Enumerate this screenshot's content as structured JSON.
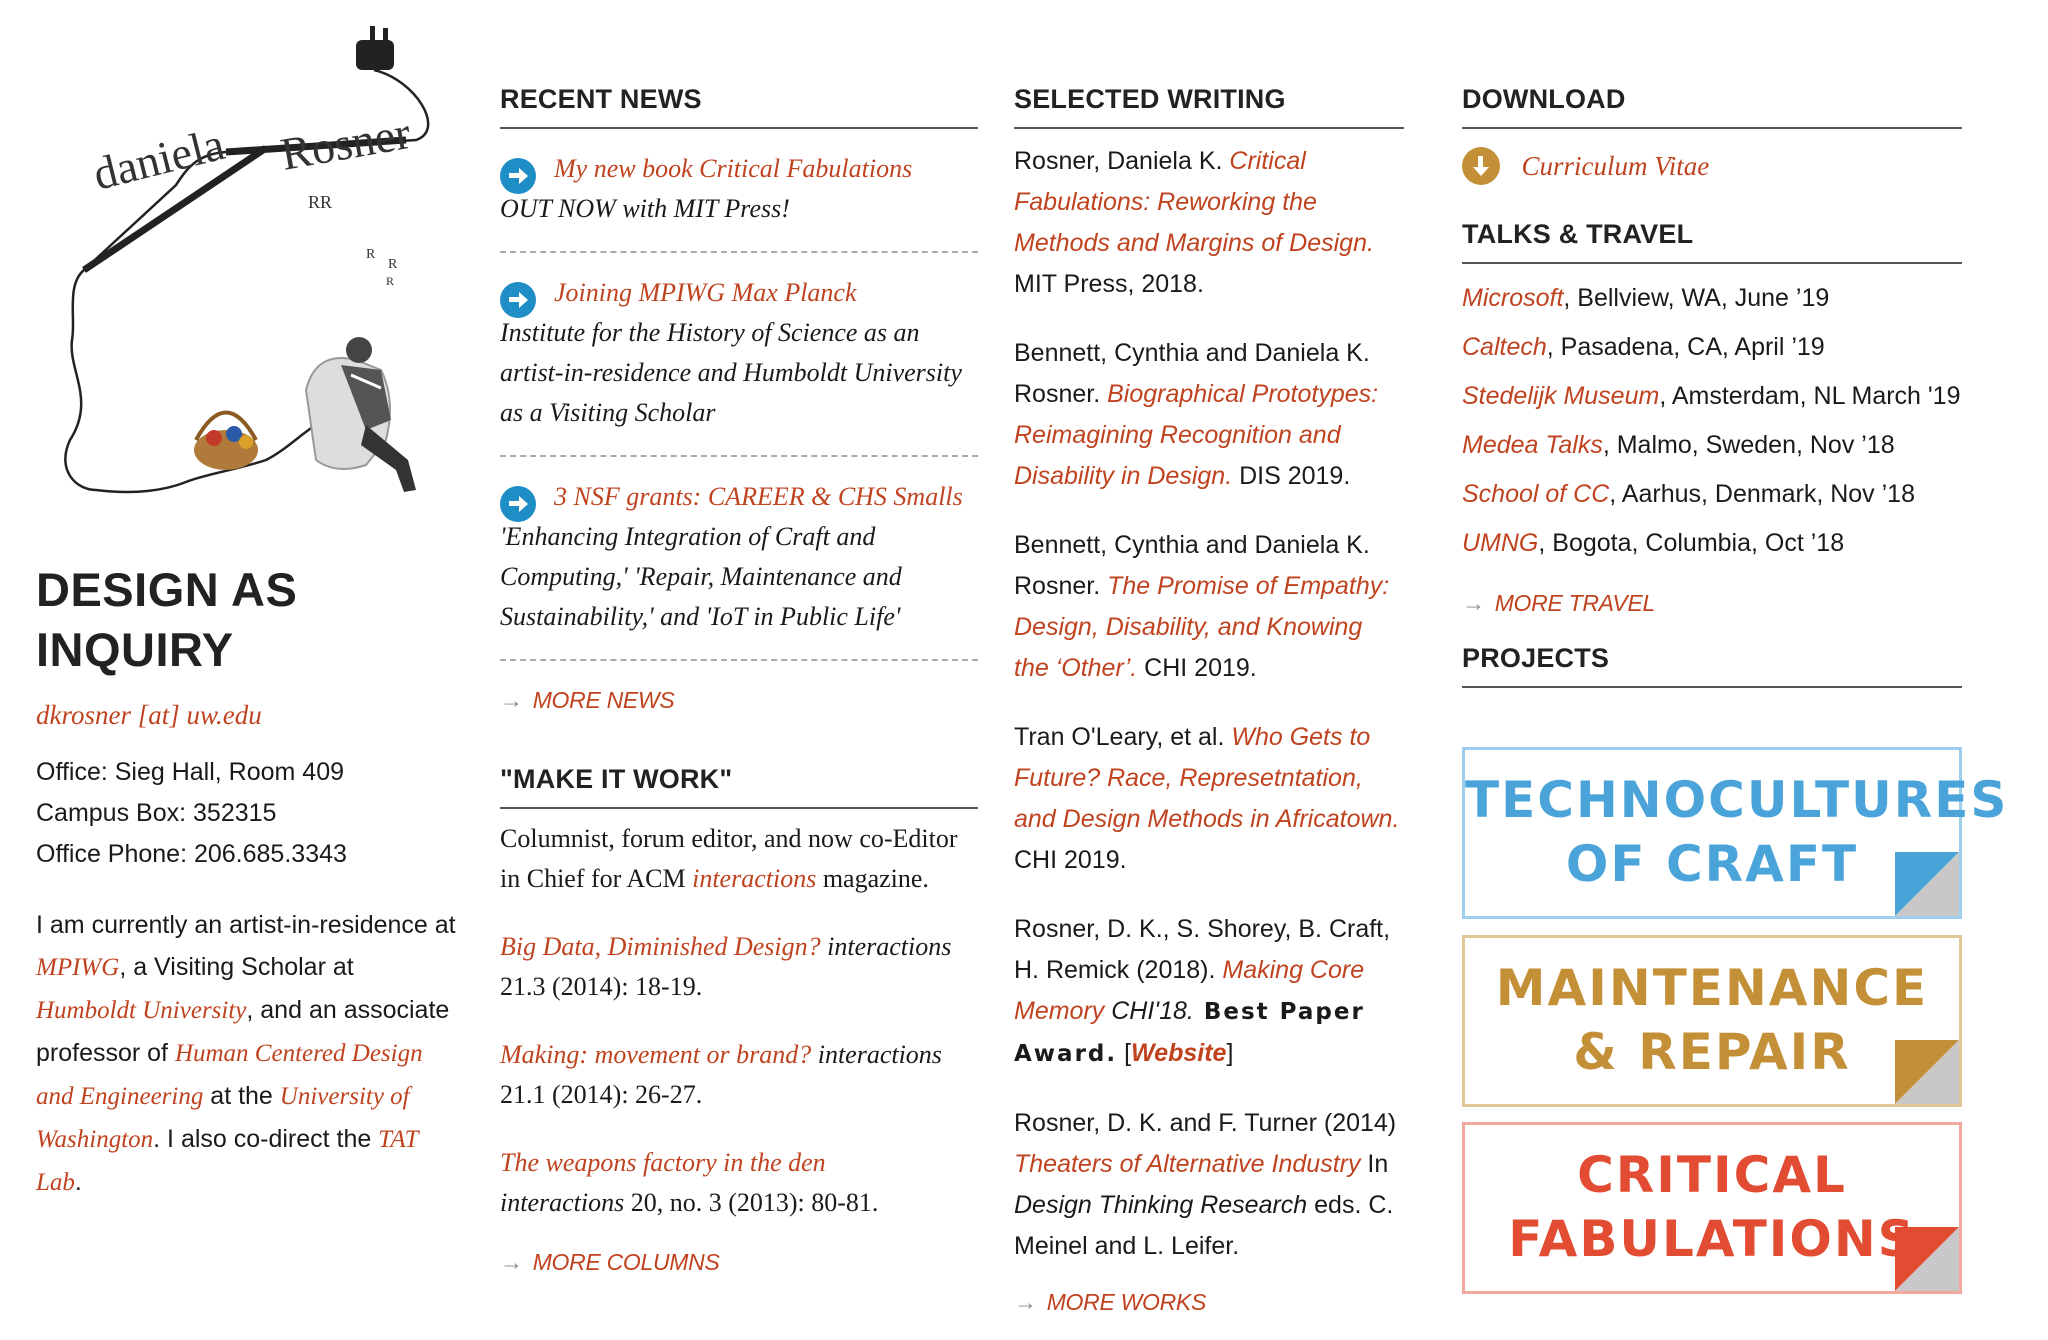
{
  "colors": {
    "accent": "#c0431f",
    "arrow_blue": "#1f8ec7",
    "cv_gold": "#c39037",
    "proj_blue": "#4aa3d9",
    "proj_gold": "#c39037",
    "proj_red": "#e24c32"
  },
  "logo": {
    "first": "daniela",
    "last": "Rosner"
  },
  "sidebar": {
    "title_line1": "DESIGN AS",
    "title_line2": "INQUIRY",
    "email": "dkrosner [at] uw.edu",
    "office": "Office: Sieg Hall, Room 409",
    "box": "Campus Box: 352315",
    "phone": "Office Phone: 206.685.3343",
    "bio_1": "I am currently an artist-in-residence at ",
    "bio_link_1": "MPIWG",
    "bio_2": ", a Visiting Scholar at ",
    "bio_link_2": "Humboldt University",
    "bio_3": ", and an associate professor of ",
    "bio_link_3": "Human Centered Design and Engineering",
    "bio_4": " at the ",
    "bio_link_4": "University of Washington",
    "bio_5": ". I also co-direct the ",
    "bio_link_5": "TAT Lab",
    "bio_6": "."
  },
  "news": {
    "heading": "RECENT NEWS",
    "items": [
      {
        "link": "My new book Critical Fabulations",
        "text": "OUT NOW with MIT Press!"
      },
      {
        "link": "Joining MPIWG Max Planck",
        "text": "Institute for the History of Science as an artist-in-residence and Humboldt University as a Visiting Scholar"
      },
      {
        "link": "3 NSF grants: CAREER & CHS Smalls",
        "text": "'Enhancing Integration of Craft and Computing,' 'Repair, Maintenance and Sustainability,' and 'IoT in Public Life'"
      }
    ],
    "more": "MORE NEWS"
  },
  "make_it_work": {
    "heading": "\"MAKE IT WORK\"",
    "intro_1": "Columnist, forum editor, and now co-Editor in Chief for ACM ",
    "intro_link": "interactions",
    "intro_2": " magazine.",
    "columns": [
      {
        "title": "Big Data, Diminished Design?",
        "journal": "interactions",
        "cite": "21.3 (2014): 18-19."
      },
      {
        "title": "Making: movement or brand?",
        "journal": "interactions",
        "cite": "21.1 (2014): 26-27."
      },
      {
        "title": "The weapons factory in the den",
        "journal": "interactions",
        "cite": "20, no. 3 (2013): 80-81."
      }
    ],
    "more": "MORE COLUMNS"
  },
  "writing": {
    "heading": "SELECTED WRITING",
    "items": [
      {
        "pre": "Rosner, Daniela K. ",
        "title": "Critical Fabulations: Reworking the Methods and Margins of Design.",
        "post": " MIT Press, 2018."
      },
      {
        "pre": "Bennett, Cynthia and Daniela K. Rosner. ",
        "title": "Biographical Prototypes: Reimagining Recognition and Disability in Design.",
        "post": " DIS 2019."
      },
      {
        "pre": "Bennett, Cynthia and Daniela K. Rosner. ",
        "title": "The Promise of Empathy: Design, Disability, and Knowing the ‘Other’.",
        "post": " CHI 2019."
      },
      {
        "pre": "Tran O'Leary, et al. ",
        "title": "Who Gets to Future? Race, Represetntation, and Design Methods in Africatown.",
        "post": " CHI 2019."
      }
    ],
    "item5_pre": "Rosner, D. K., S. Shorey, B. Craft, H. Remick (2018). ",
    "item5_title": "Making Core Memory",
    "item5_venue": " CHI'18.",
    "item5_award": " Best Paper Award.",
    "item5_open": " [",
    "item5_link": "Website",
    "item5_close": "]",
    "item6_pre": "Rosner, D. K. and F. Turner (2014) ",
    "item6_title": "Theaters of Alternative Industry",
    "item6_in": " In ",
    "item6_book": "Design Thinking Research",
    "item6_post": " eds. C. Meinel and L. Leifer.",
    "more": "MORE WORKS"
  },
  "download": {
    "heading": "DOWNLOAD",
    "cv": "Curriculum Vitae"
  },
  "talks": {
    "heading": "TALKS & TRAVEL",
    "items": [
      {
        "place": "Microsoft",
        "rest": ", Bellview, WA, June ’19"
      },
      {
        "place": "Caltech",
        "rest": ", Pasadena, CA, April ’19"
      },
      {
        "place": "Stedelijk Museum",
        "rest": ", Amsterdam, NL March '19"
      },
      {
        "place": "Medea Talks",
        "rest": ", Malmo, Sweden, Nov ’18"
      },
      {
        "place": "School of CC",
        "rest": ", Aarhus, Denmark, Nov ’18"
      },
      {
        "place": "UMNG",
        "rest": ", Bogota, Columbia, Oct ’18"
      }
    ],
    "more": "MORE TRAVEL"
  },
  "projects": {
    "heading": "PROJECTS",
    "p1_l1": "TECHNOCULTURES",
    "p1_l2": "OF CRAFT",
    "p2_l1": "MAINTENANCE",
    "p2_l2": "& REPAIR",
    "p3_l1": "CRITICAL",
    "p3_l2": "FABULATIONS"
  }
}
